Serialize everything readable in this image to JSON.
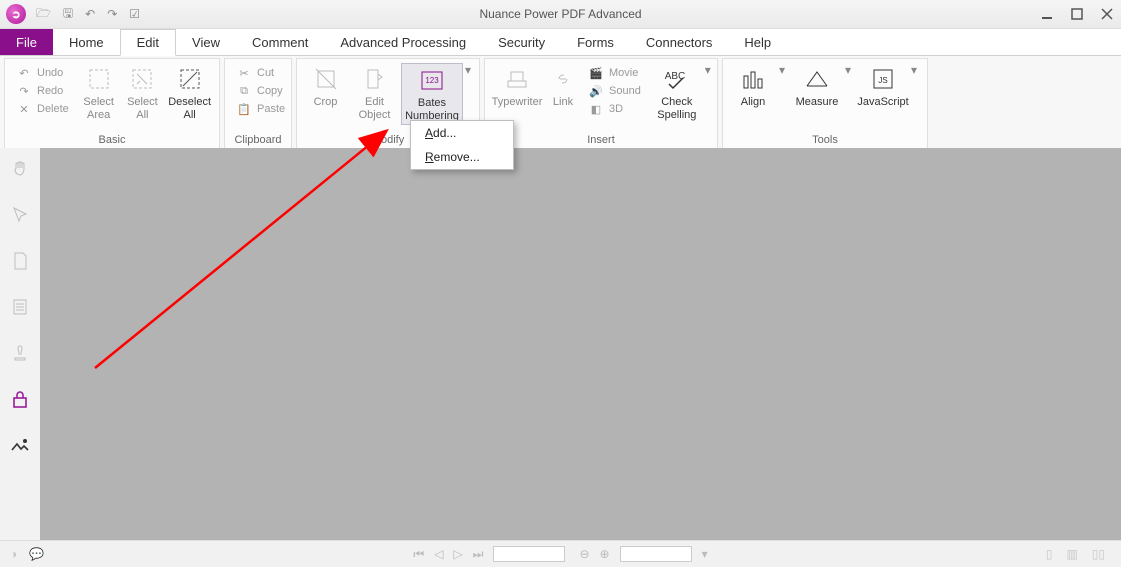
{
  "window": {
    "title": "Nuance Power PDF Advanced"
  },
  "qat": [
    "open",
    "save",
    "undo",
    "redo",
    "checkbox"
  ],
  "tabs": {
    "file": "File",
    "items": [
      "Home",
      "Edit",
      "View",
      "Comment",
      "Advanced Processing",
      "Security",
      "Forms",
      "Connectors",
      "Help"
    ],
    "active": "Edit"
  },
  "ribbon": {
    "basic": {
      "label": "Basic",
      "undo": "Undo",
      "redo": "Redo",
      "delete": "Delete",
      "select_area": "Select Area",
      "select_all": "Select All",
      "deselect_all": "Deselect All"
    },
    "clipboard": {
      "label": "Clipboard",
      "cut": "Cut",
      "copy": "Copy",
      "paste": "Paste"
    },
    "modify": {
      "label": "Modify",
      "crop": "Crop",
      "edit_object": "Edit Object",
      "bates": "Bates Numbering"
    },
    "insert": {
      "label": "Insert",
      "typewriter": "Typewriter",
      "link": "Link",
      "movie": "Movie",
      "sound": "Sound",
      "threeD": "3D",
      "check_spelling": "Check Spelling"
    },
    "tools": {
      "label": "Tools",
      "align": "Align",
      "measure": "Measure",
      "javascript": "JavaScript"
    }
  },
  "dropdown": {
    "add": "Add...",
    "remove": "Remove..."
  },
  "accent": "#8a0f8a"
}
